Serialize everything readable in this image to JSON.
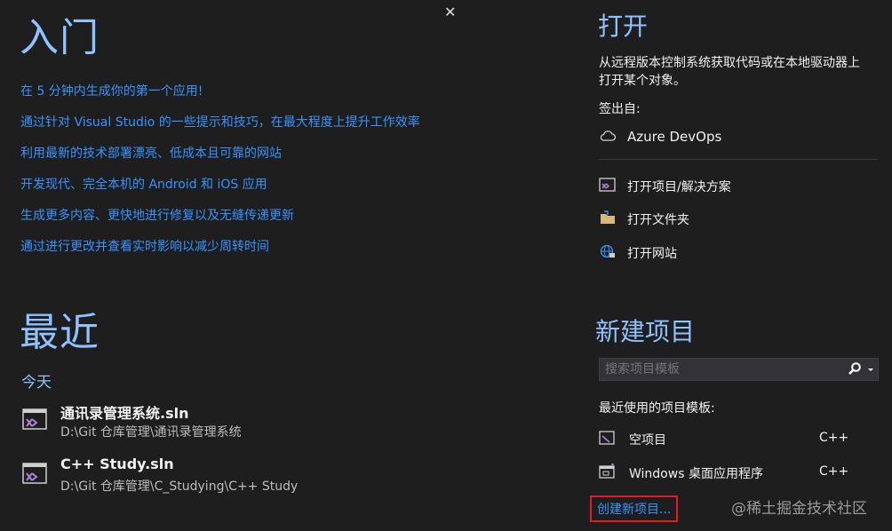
{
  "close_glyph": "✕",
  "getting_started": {
    "title": "入门",
    "links": [
      "在 5 分钟内生成你的第一个应用!",
      "通过针对 Visual Studio 的一些提示和技巧，在最大程度上提升工作效率",
      "利用最新的技术部署漂亮、低成本且可靠的网站",
      "开发现代、完全本机的 Android 和 iOS 应用",
      "生成更多内容、更快地进行修复以及无缝传递更新",
      "通过进行更改并查看实时影响以减少周转时间"
    ]
  },
  "recent": {
    "title": "最近",
    "group": "今天",
    "items": [
      {
        "name": "通讯录管理系统.sln",
        "path": "D:\\Git 仓库管理\\通讯录管理系统"
      },
      {
        "name": "C++ Study.sln",
        "path": "D:\\Git 仓库管理\\C_Studying\\C++ Study"
      }
    ]
  },
  "open": {
    "title": "打开",
    "description_line1": "从远程版本控制系统获取代码或在本地驱动器上",
    "description_line2": "打开某个对象。",
    "checkout_label": "签出自:",
    "azure": "Azure DevOps",
    "items": [
      "打开项目/解决方案",
      "打开文件夹",
      "打开网站"
    ]
  },
  "new_project": {
    "title": "新建项目",
    "search_placeholder": "搜索项目模板",
    "recent_templates_label": "最近使用的项目模板:",
    "templates": [
      {
        "name": "空项目",
        "lang": "C++"
      },
      {
        "name": "Windows 桌面应用程序",
        "lang": "C++"
      }
    ],
    "create_link": "创建新项目..."
  },
  "watermark": "@稀土掘金技术社区",
  "colors": {
    "background": "#1e1e1e",
    "heading": "#8fc3ff",
    "link": "#3794ff",
    "highlight_box": "#e31b23"
  }
}
